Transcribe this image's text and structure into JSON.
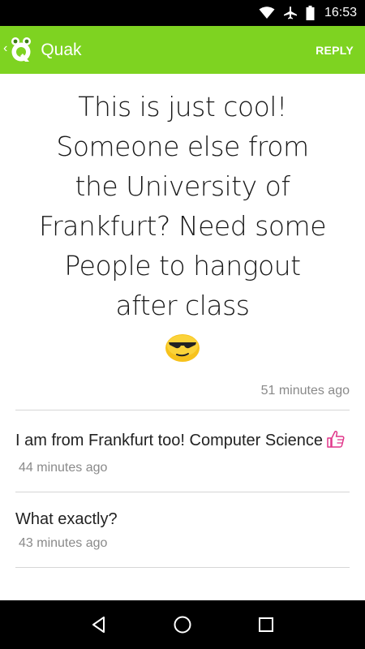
{
  "status_bar": {
    "time": "16:53",
    "icons": [
      "wifi-icon",
      "airplane-mode-icon",
      "battery-icon"
    ]
  },
  "app_bar": {
    "back_chevron": "‹",
    "logo_icon": "quak-logo-icon",
    "title": "Quak",
    "reply_label": "REPLY"
  },
  "post": {
    "text": "This is just cool! Someone else from the University of Frankfurt? Need some People to hangout after class",
    "emoji": "sunglasses-emoji",
    "time": "51 minutes ago"
  },
  "replies": [
    {
      "text": "I am from Frankfurt too! Computer Science",
      "emoji": "thumbs-up-icon",
      "time": "44 minutes ago"
    },
    {
      "text": "What exactly?",
      "time": "43 minutes ago"
    }
  ],
  "nav_bar": {
    "buttons": [
      "back-icon",
      "home-icon",
      "recents-icon"
    ]
  },
  "colors": {
    "accent": "#7ed321",
    "thumbs_up": "#e0378a"
  }
}
